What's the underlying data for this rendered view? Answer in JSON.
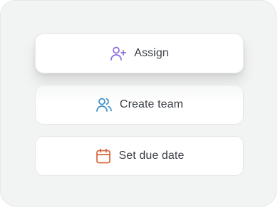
{
  "actions": [
    {
      "label": "Assign",
      "icon": "user-plus-icon",
      "color": "#8a6ae0"
    },
    {
      "label": "Create team",
      "icon": "users-icon",
      "color": "#3a8fc9"
    },
    {
      "label": "Set due date",
      "icon": "calendar-icon",
      "color": "#d9653b"
    }
  ],
  "colors": {
    "panel_bg": "#f2f3f3",
    "card_bg": "#ffffff",
    "text": "#3a3f45"
  }
}
